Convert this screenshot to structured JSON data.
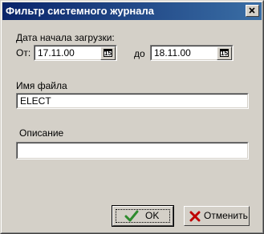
{
  "window": {
    "title": "Фильтр системного журнала"
  },
  "date_group": {
    "label": "Дата начала загрузки:",
    "from_label": "От:",
    "from_value": "17.11.00",
    "to_label": "до",
    "to_value": "18.11.00",
    "calendar_glyph": "15"
  },
  "file": {
    "label": "Имя файла",
    "value": "ELECT"
  },
  "description": {
    "label": "Описание",
    "value": ""
  },
  "buttons": {
    "ok": "OK",
    "cancel": "Отменить"
  },
  "colors": {
    "title_start": "#0a246a",
    "title_end": "#3a6ea5",
    "ok_check": "#2e8b2e",
    "cancel_x": "#c00000",
    "face": "#d4d0c8"
  },
  "icons": {
    "close": "close-icon",
    "calendar": "calendar-icon",
    "ok": "checkmark-icon",
    "cancel": "cross-icon"
  }
}
